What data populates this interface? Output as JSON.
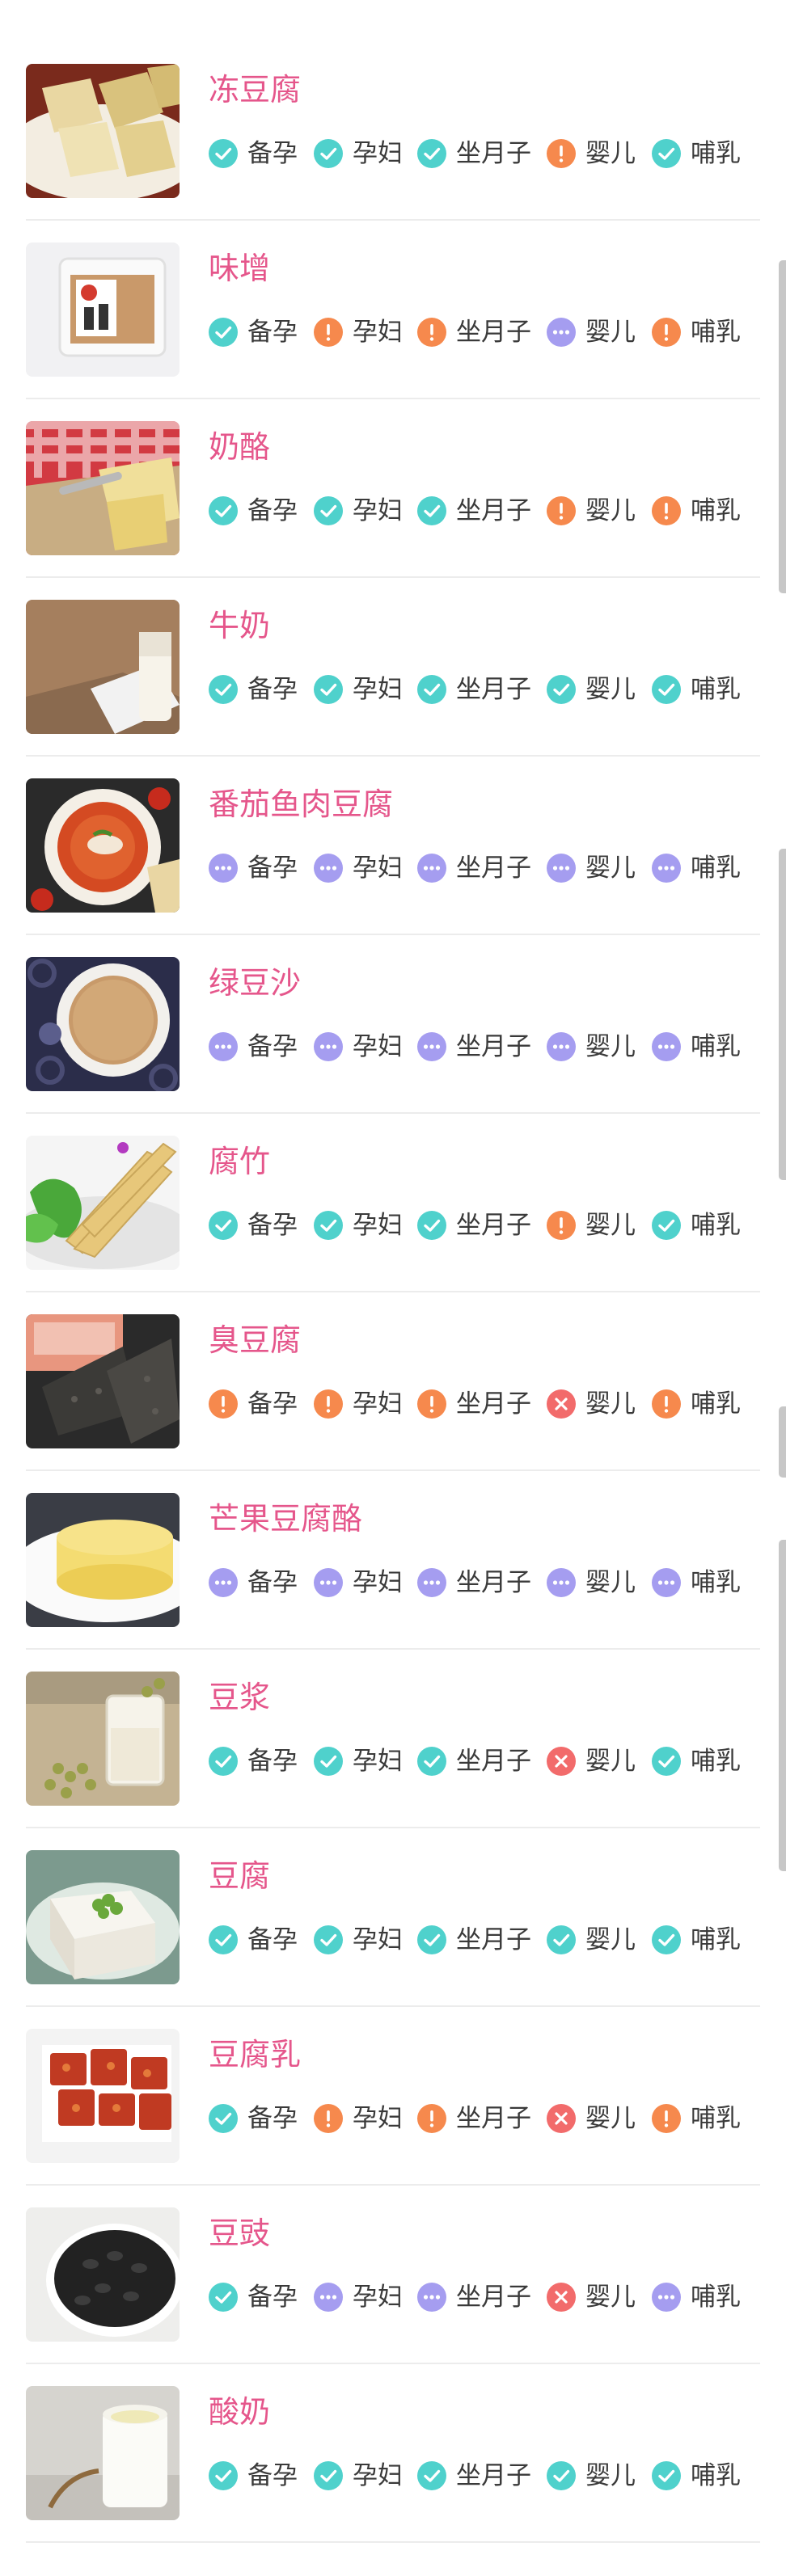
{
  "status_colors": {
    "ok": "#4fd1cc",
    "warn": "#f6894d",
    "no": "#f26b6b",
    "unk": "#a59df0"
  },
  "status_icons": {
    "ok": "check-icon",
    "warn": "exclamation-icon",
    "no": "cross-icon",
    "unk": "ellipsis-icon"
  },
  "groups": [
    "备孕",
    "孕妇",
    "坐月子",
    "婴儿",
    "哺乳"
  ],
  "foods": [
    {
      "name": "冻豆腐",
      "status": [
        "ok",
        "ok",
        "ok",
        "warn",
        "ok"
      ]
    },
    {
      "name": "味增",
      "status": [
        "ok",
        "warn",
        "warn",
        "unk",
        "warn"
      ]
    },
    {
      "name": "奶酪",
      "status": [
        "ok",
        "ok",
        "ok",
        "warn",
        "warn"
      ]
    },
    {
      "name": "牛奶",
      "status": [
        "ok",
        "ok",
        "ok",
        "ok",
        "ok"
      ]
    },
    {
      "name": "番茄鱼肉豆腐",
      "status": [
        "unk",
        "unk",
        "unk",
        "unk",
        "unk"
      ]
    },
    {
      "name": "绿豆沙",
      "status": [
        "unk",
        "unk",
        "unk",
        "unk",
        "unk"
      ]
    },
    {
      "name": "腐竹",
      "status": [
        "ok",
        "ok",
        "ok",
        "warn",
        "ok"
      ]
    },
    {
      "name": "臭豆腐",
      "status": [
        "warn",
        "warn",
        "warn",
        "no",
        "warn"
      ]
    },
    {
      "name": "芒果豆腐酪",
      "status": [
        "unk",
        "unk",
        "unk",
        "unk",
        "unk"
      ]
    },
    {
      "name": "豆浆",
      "status": [
        "ok",
        "ok",
        "ok",
        "no",
        "ok"
      ]
    },
    {
      "name": "豆腐",
      "status": [
        "ok",
        "ok",
        "ok",
        "ok",
        "ok"
      ]
    },
    {
      "name": "豆腐乳",
      "status": [
        "ok",
        "warn",
        "warn",
        "no",
        "warn"
      ]
    },
    {
      "name": "豆豉",
      "status": [
        "ok",
        "unk",
        "unk",
        "no",
        "unk"
      ]
    },
    {
      "name": "酸奶",
      "status": [
        "ok",
        "ok",
        "ok",
        "ok",
        "ok"
      ]
    }
  ]
}
